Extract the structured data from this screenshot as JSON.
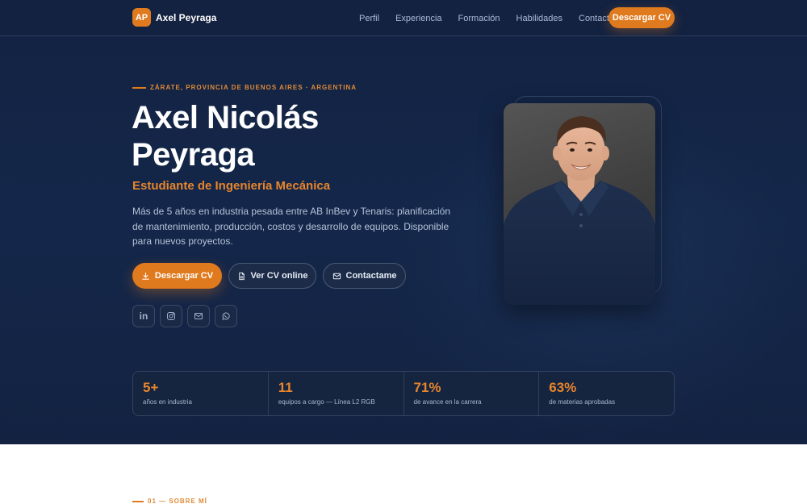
{
  "brand": {
    "initials": "AP",
    "name": "Axel Peyraga"
  },
  "nav": {
    "items": [
      {
        "label": "Perfil"
      },
      {
        "label": "Experiencia"
      },
      {
        "label": "Formación"
      },
      {
        "label": "Habilidades"
      },
      {
        "label": "Contacto"
      }
    ],
    "cta_label": "Descargar CV"
  },
  "hero": {
    "eyebrow": "ZÁRATE, PROVINCIA DE BUENOS AIRES · ARGENTINA",
    "name_line1": "Axel Nicolás",
    "name_line2": "Peyraga",
    "role": "Estudiante de Ingeniería Mecánica",
    "bio": "Más de 5 años en industria pesada entre AB InBev y Tenaris: planificación de mantenimiento, producción, costos y desarrollo de equipos. Disponible para nuevos proyectos.",
    "buttons": {
      "download": "Descargar CV",
      "view": "Ver CV online",
      "contact": "Contactame"
    },
    "socials": [
      {
        "icon": "linkedin-icon",
        "text": "in"
      },
      {
        "icon": "instagram-icon"
      },
      {
        "icon": "mail-icon"
      },
      {
        "icon": "whatsapp-icon"
      }
    ]
  },
  "stats": [
    {
      "value": "5+",
      "label": "años en industria"
    },
    {
      "value": "11",
      "label": "equipos a cargo — Línea L2 RGB"
    },
    {
      "value": "71%",
      "label": "de avance en la carrera"
    },
    {
      "value": "63%",
      "label": "de materias aprobadas"
    }
  ],
  "section": {
    "eyebrow": "01 — SOBRE MÍ"
  },
  "colors": {
    "accent": "#e07a1e",
    "navy": "#132241",
    "text_muted": "#b4c2d8"
  }
}
